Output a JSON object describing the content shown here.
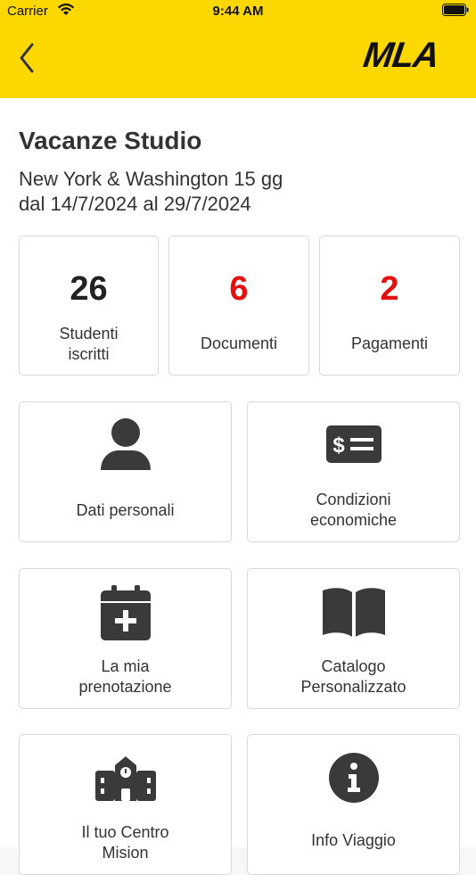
{
  "status_bar": {
    "carrier": "Carrier",
    "time": "9:44 AM"
  },
  "header": {
    "logo": "MLA"
  },
  "trip": {
    "title": "Vacanze Studio",
    "destination": "New York & Washington 15 gg",
    "dates": "dal 14/7/2024 al 29/7/2024"
  },
  "stats": [
    {
      "value": "26",
      "label_line1": "Studenti",
      "label_line2": "iscritti",
      "color": "#222222"
    },
    {
      "value": "6",
      "label": "Documenti",
      "color": "#e41010"
    },
    {
      "value": "2",
      "label": "Pagamenti",
      "color": "#e41010"
    }
  ],
  "menu": [
    {
      "label_line1": "Dati personali",
      "icon": "user-icon"
    },
    {
      "label_line1": "Condizioni",
      "label_line2": "economiche",
      "icon": "money-bill-icon"
    },
    {
      "label_line1": "La mia",
      "label_line2": "prenotazione",
      "icon": "calendar-plus-icon"
    },
    {
      "label_line1": "Catalogo",
      "label_line2": "Personalizzato",
      "icon": "book-icon"
    },
    {
      "label_line1": "Il tuo Centro",
      "label_line2": "Mision",
      "icon": "school-icon"
    },
    {
      "label_line1": "Info Viaggio",
      "icon": "info-icon"
    }
  ]
}
